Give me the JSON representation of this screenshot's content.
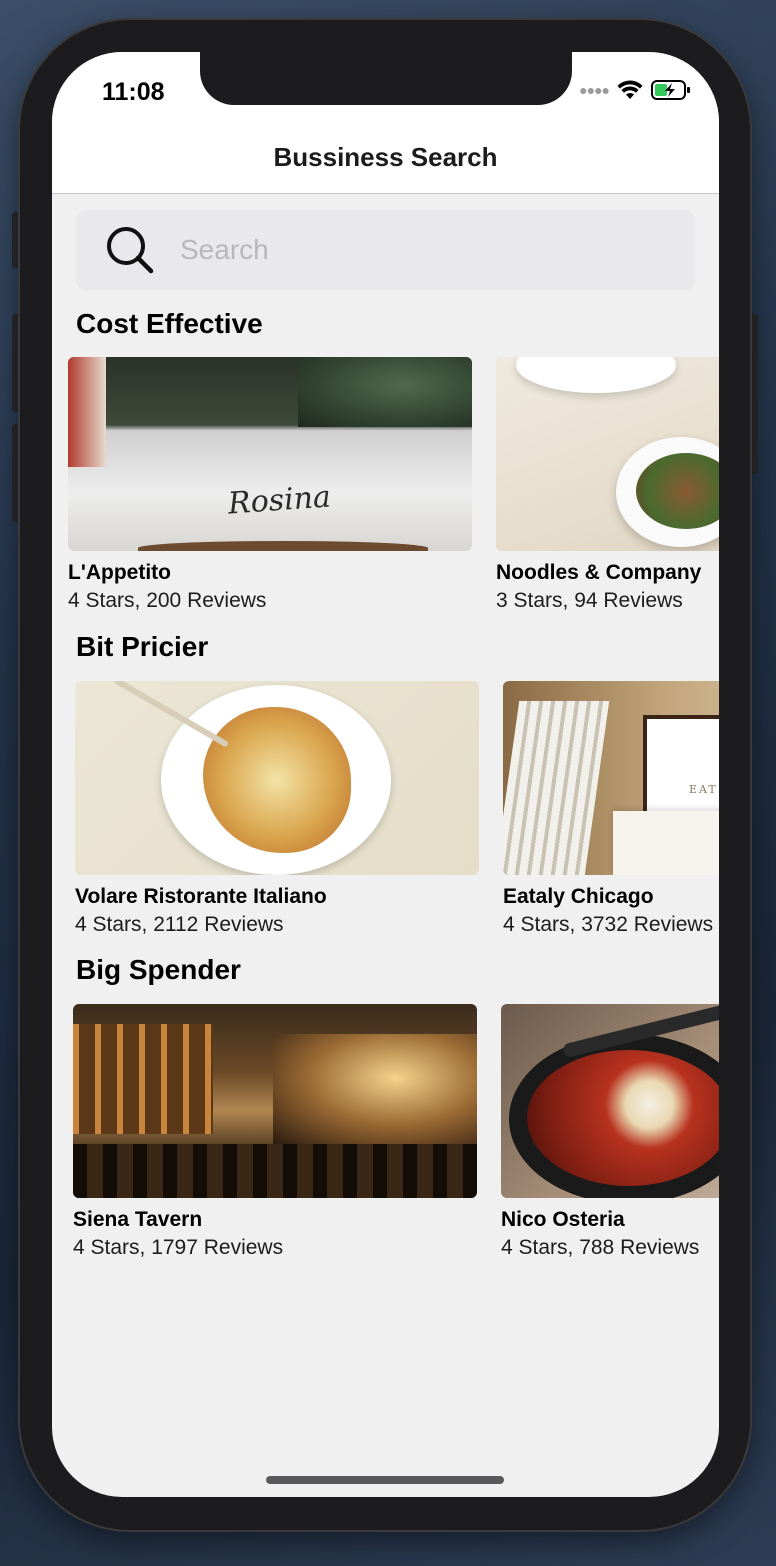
{
  "status_bar": {
    "time": "11:08"
  },
  "nav": {
    "title": "Bussiness Search"
  },
  "search": {
    "placeholder": "Search",
    "value": ""
  },
  "sections": [
    {
      "title": "Cost Effective",
      "items": [
        {
          "name": "L'Appetito",
          "meta": "4 Stars, 200 Reviews"
        },
        {
          "name": "Noodles & Company",
          "meta": "3 Stars, 94 Reviews"
        }
      ]
    },
    {
      "title": "Bit Pricier",
      "items": [
        {
          "name": "Volare Ristorante Italiano",
          "meta": "4 Stars, 2112 Reviews"
        },
        {
          "name": "Eataly Chicago",
          "meta": "4 Stars, 3732 Reviews"
        }
      ]
    },
    {
      "title": "Big Spender",
      "items": [
        {
          "name": "Siena Tavern",
          "meta": "4 Stars, 1797 Reviews"
        },
        {
          "name": "Nico Osteria",
          "meta": "4 Stars, 788 Reviews"
        }
      ]
    }
  ],
  "photo_text": {
    "rosina": "Rosina",
    "eat": "EAT"
  },
  "colors": {
    "background": "#f0f0f0",
    "nav_bar": "#ffffff",
    "search_field": "#e9e9eb",
    "battery_charging": "#34c759"
  }
}
